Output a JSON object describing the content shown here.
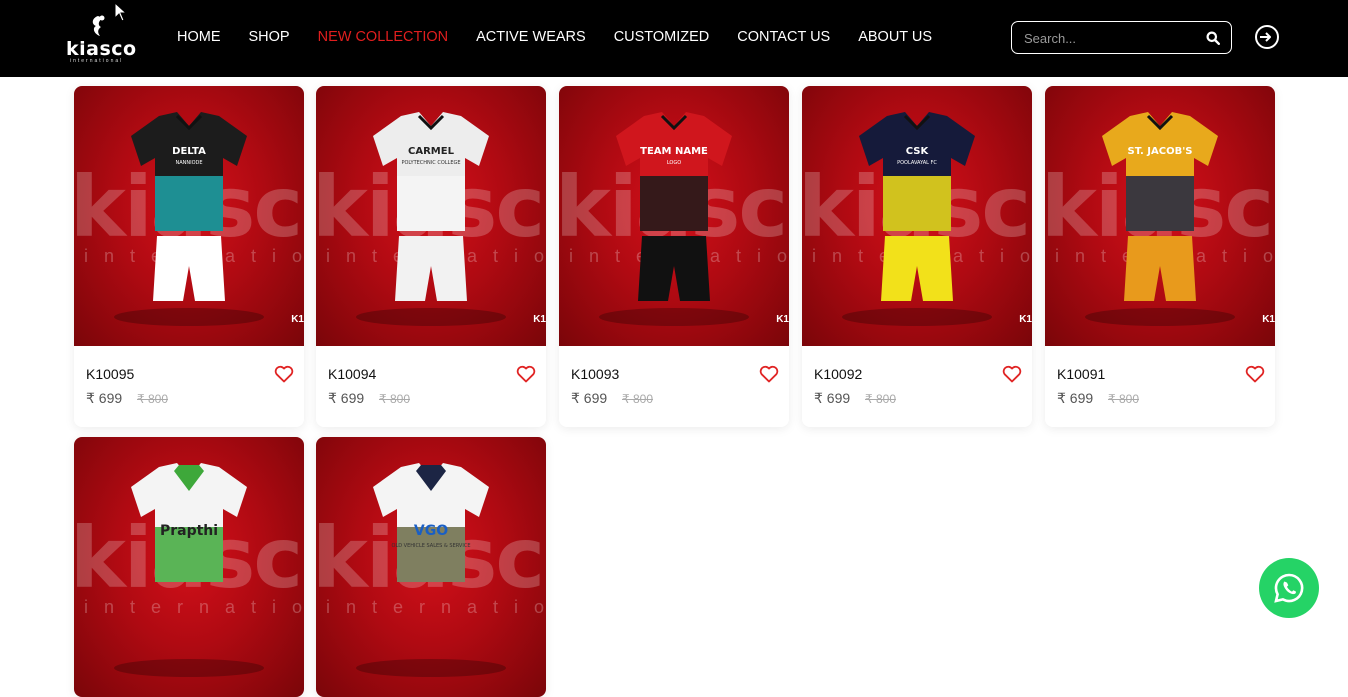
{
  "brand": {
    "name": "kiasco",
    "tagline": "international"
  },
  "nav": [
    {
      "label": "HOME"
    },
    {
      "label": "SHOP"
    },
    {
      "label": "NEW COLLECTION",
      "active": true
    },
    {
      "label": "ACTIVE WEARS"
    },
    {
      "label": "CUSTOMIZED"
    },
    {
      "label": "CONTACT US"
    },
    {
      "label": "ABOUT US"
    }
  ],
  "search": {
    "placeholder": "Search..."
  },
  "watermark": {
    "main": "kiasco",
    "sub": "international"
  },
  "products": [
    {
      "code": "K10095",
      "price": "₹ 699",
      "old_price": "₹ 800",
      "badge": "K1",
      "kit_text": "DELTA",
      "kit_text2": "NANNIODE",
      "colors": {
        "top": "#1c1c1c",
        "mid": "#1fa3a8",
        "shorts": "#ffffff"
      }
    },
    {
      "code": "K10094",
      "price": "₹ 699",
      "old_price": "₹ 800",
      "badge": "K1",
      "kit_text": "CARMEL",
      "kit_text2": "POLYTECHNIC COLLEGE",
      "colors": {
        "top": "#ededed",
        "mid": "#f5f5f5",
        "shorts": "#f2f2f2"
      }
    },
    {
      "code": "K10093",
      "price": "₹ 699",
      "old_price": "₹ 800",
      "badge": "K1",
      "kit_text": "TEAM NAME",
      "kit_text2": "LOGO",
      "colors": {
        "top": "#d0161d",
        "mid": "#1a1a1a",
        "shorts": "#111111"
      }
    },
    {
      "code": "K10092",
      "price": "₹ 699",
      "old_price": "₹ 800",
      "badge": "K1",
      "kit_text": "CSK",
      "kit_text2": "POOLAVAYAL FC",
      "colors": {
        "top": "#151a3a",
        "mid": "#f2e11a",
        "shorts": "#f2e11a"
      }
    },
    {
      "code": "K10091",
      "price": "₹ 699",
      "old_price": "₹ 800",
      "badge": "K1",
      "kit_text": "ST. JACOB'S",
      "kit_text2": "",
      "colors": {
        "top": "#e8a91c",
        "mid": "#1c2544",
        "shorts": "#e89a1c"
      }
    },
    {
      "code": "",
      "price": "",
      "old_price": "",
      "badge": "",
      "kit_text": "Prapthi",
      "kit_text2": "",
      "colors": {
        "top": "#f4f4f4",
        "mid": "#3ea83a",
        "shorts": "#f4f4f4"
      }
    },
    {
      "code": "",
      "price": "",
      "old_price": "",
      "badge": "",
      "kit_text": "VGO",
      "kit_text2": "OLD VEHICLE SALES & SERVICE",
      "colors": {
        "top": "#f4f4f4",
        "mid": "#6a6a45",
        "shorts": "#f4f4f4"
      }
    }
  ],
  "accent_colors": {
    "nav_active": "#e01e1e",
    "heart": "#e02424",
    "whatsapp": "#25d366"
  }
}
